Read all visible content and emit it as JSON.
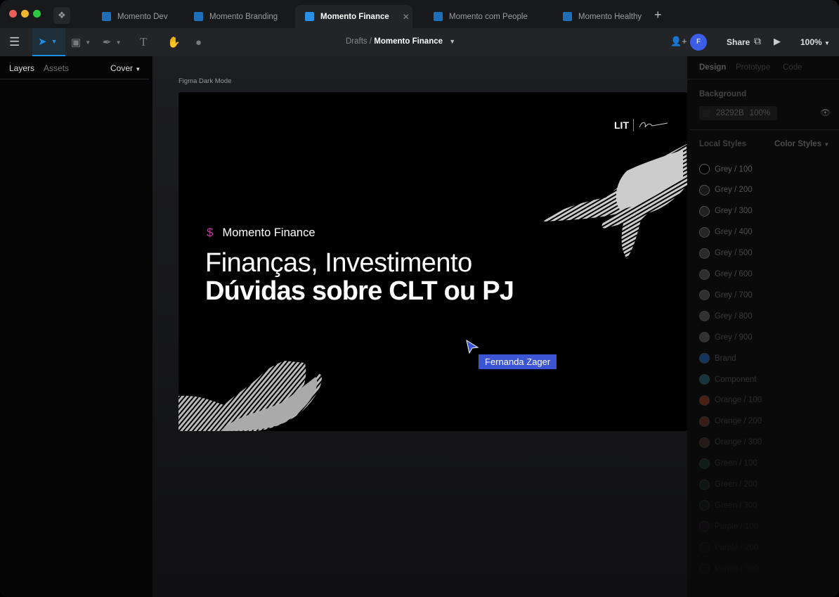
{
  "tabs": [
    {
      "label": "Momento Dev"
    },
    {
      "label": "Momento Branding"
    },
    {
      "label": "Momento Finance",
      "active": true
    },
    {
      "label": "Momento com People"
    },
    {
      "label": "Momento Healthy"
    }
  ],
  "toolbar": {
    "breadcrumb_parent": "Drafts /",
    "file_name": "Momento Finance",
    "avatar_initial": "F",
    "share_label": "Share",
    "zoom": "100%"
  },
  "left_panel": {
    "tab_layers": "Layers",
    "tab_assets": "Assets",
    "page": "Cover"
  },
  "canvas": {
    "frame_label": "Figma Dark Mode",
    "logo_text": "LIT",
    "brand": "Momento Finance",
    "brand_icon": "$",
    "title_line1": "Finanças, Investimento",
    "title_line2": "Dúvidas sobre CLT ou PJ",
    "cursor_user": "Fernanda Zager",
    "cursor_color": "#3c55d4"
  },
  "right_panel": {
    "tabs": [
      "Design",
      "Prototype",
      "Code"
    ],
    "background_label": "Background",
    "bg_hex": "28292B",
    "bg_opacity": "100%",
    "local_styles": "Local Styles",
    "styles_filter": "Color Styles",
    "styles": [
      {
        "name": "Grey / 100",
        "color": "#000000"
      },
      {
        "name": "Grey / 200",
        "color": "#1a1a1a"
      },
      {
        "name": "Grey / 300",
        "color": "#242424"
      },
      {
        "name": "Grey / 400",
        "color": "#2c2c2c"
      },
      {
        "name": "Grey / 500",
        "color": "#333333"
      },
      {
        "name": "Grey / 600",
        "color": "#3a3a3a"
      },
      {
        "name": "Grey / 700",
        "color": "#404040"
      },
      {
        "name": "Grey / 800",
        "color": "#474747"
      },
      {
        "name": "Grey / 900",
        "color": "#4e4e4e"
      },
      {
        "name": "Brand",
        "color": "#1b57a0"
      },
      {
        "name": "Component",
        "color": "#1e6474"
      },
      {
        "name": "Orange / 100",
        "color": "#9a3c20"
      },
      {
        "name": "Orange / 200",
        "color": "#7a3a28"
      },
      {
        "name": "Orange / 300",
        "color": "#5a3a32"
      },
      {
        "name": "Green / 100",
        "color": "#1c4a3c"
      },
      {
        "name": "Green / 200",
        "color": "#1c3c34"
      },
      {
        "name": "Green / 300",
        "color": "#222a28"
      },
      {
        "name": "Purple / 100",
        "color": "#2a1430"
      },
      {
        "name": "Purple / 200",
        "color": "#201822"
      },
      {
        "name": "Purple / 300",
        "color": "#1a1a1a"
      }
    ]
  }
}
